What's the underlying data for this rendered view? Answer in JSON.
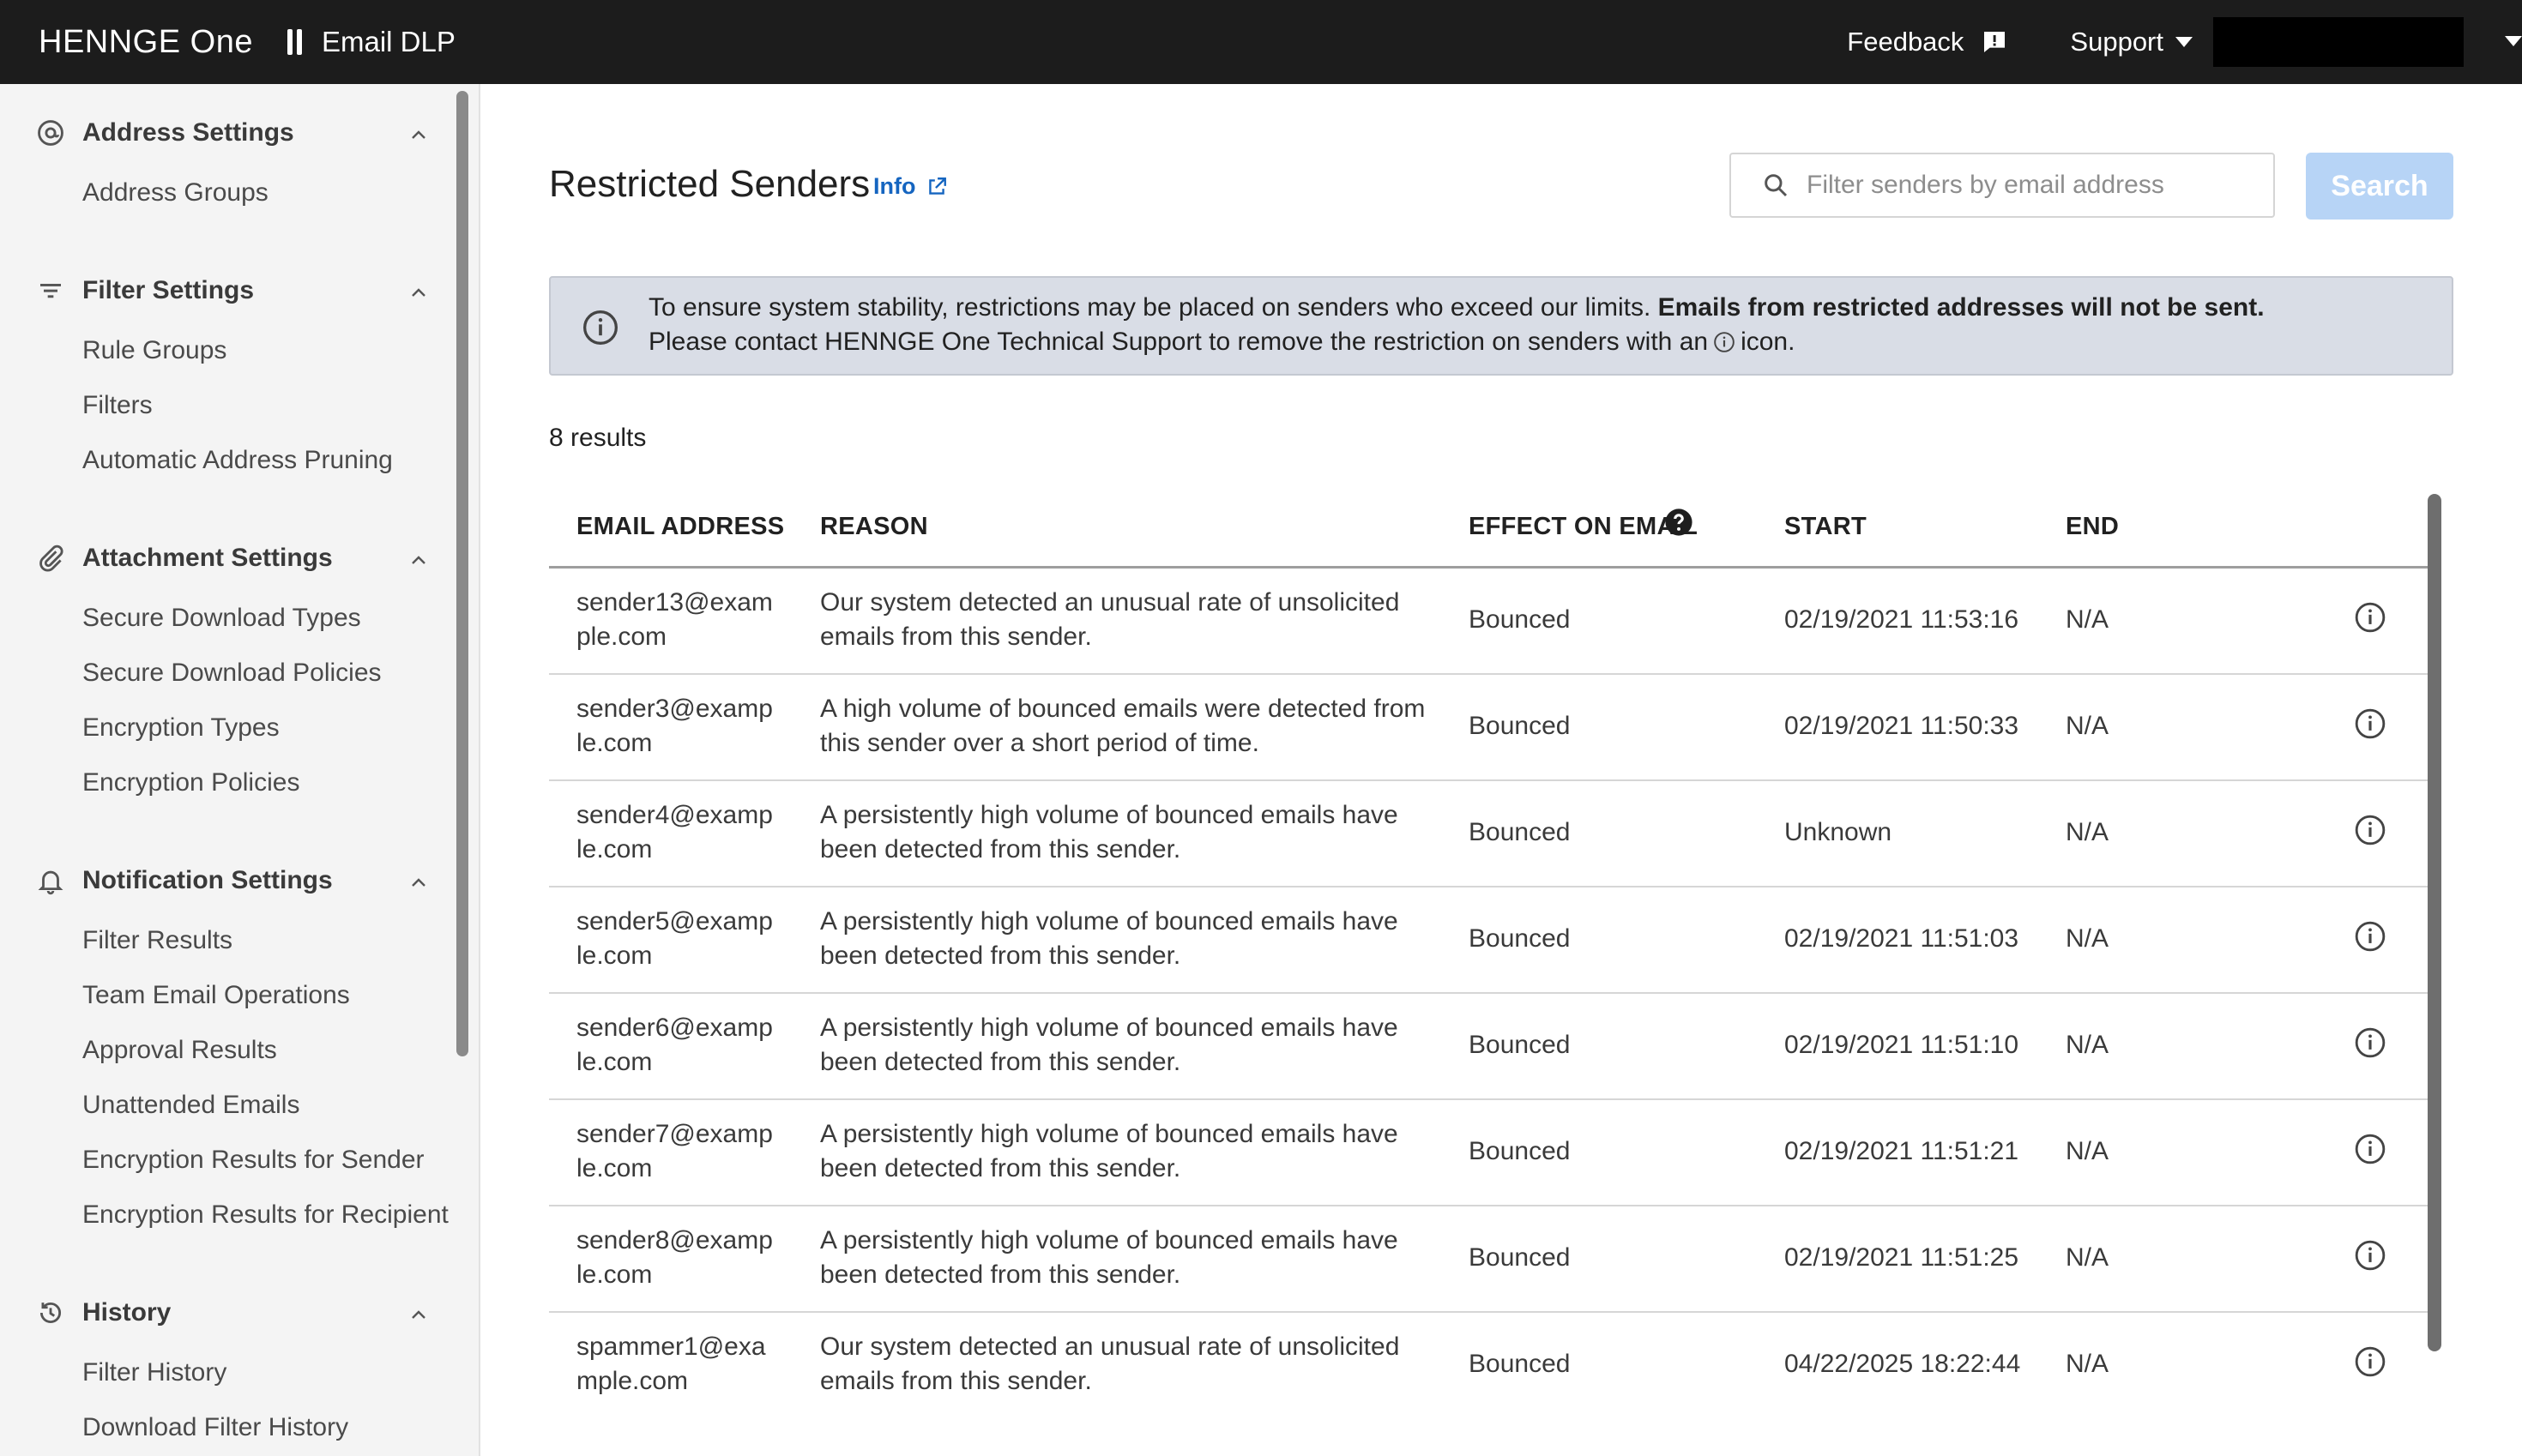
{
  "header": {
    "logo_text_a": "HENNGE",
    "logo_text_b": "One",
    "product": "Email DLP",
    "feedback_label": "Feedback",
    "support_label": "Support"
  },
  "sidebar": {
    "groups": [
      {
        "label": "Address Settings",
        "icon": "at-icon",
        "items": [
          "Address Groups"
        ]
      },
      {
        "label": "Filter Settings",
        "icon": "filter-icon",
        "items": [
          "Rule Groups",
          "Filters",
          "Automatic Address Pruning"
        ]
      },
      {
        "label": "Attachment Settings",
        "icon": "paperclip-icon",
        "items": [
          "Secure Download Types",
          "Secure Download Policies",
          "Encryption Types",
          "Encryption Policies"
        ]
      },
      {
        "label": "Notification Settings",
        "icon": "bell-icon",
        "items": [
          "Filter Results",
          "Team Email Operations",
          "Approval Results",
          "Unattended Emails",
          "Encryption Results for Sender",
          "Encryption Results for Recipient"
        ]
      },
      {
        "label": "History",
        "icon": "history-icon",
        "items": [
          "Filter History",
          "Download Filter History"
        ]
      }
    ]
  },
  "main": {
    "title": "Restricted Senders",
    "info_label": "Info",
    "search": {
      "placeholder": "Filter senders by email address",
      "button_label": "Search"
    },
    "notice": {
      "line1_plain": "To ensure system stability, restrictions may be placed on senders who exceed our limits. ",
      "line1_bold": "Emails from restricted addresses will not be sent.",
      "line2_before": "Please contact HENNGE One Technical Support to remove the restriction on senders with an",
      "line2_after": "icon."
    },
    "result_count": "8 results",
    "table": {
      "columns": {
        "email": "EMAIL ADDRESS",
        "reason": "REASON",
        "effect": "EFFECT ON EMAIL",
        "start": "START",
        "end": "END"
      },
      "rows": [
        {
          "email": "sender13@example.com",
          "reason": "Our system detected an unusual rate of unsolicited emails from this sender.",
          "effect": "Bounced",
          "start": "02/19/2021 11:53:16",
          "end": "N/A"
        },
        {
          "email": "sender3@example.com",
          "reason": "A high volume of bounced emails were detected from this sender over a short period of time.",
          "effect": "Bounced",
          "start": "02/19/2021 11:50:33",
          "end": "N/A"
        },
        {
          "email": "sender4@example.com",
          "reason": "A persistently high volume of bounced emails have been detected from this sender.",
          "effect": "Bounced",
          "start": "Unknown",
          "end": "N/A"
        },
        {
          "email": "sender5@example.com",
          "reason": "A persistently high volume of bounced emails have been detected from this sender.",
          "effect": "Bounced",
          "start": "02/19/2021 11:51:03",
          "end": "N/A"
        },
        {
          "email": "sender6@example.com",
          "reason": "A persistently high volume of bounced emails have been detected from this sender.",
          "effect": "Bounced",
          "start": "02/19/2021 11:51:10",
          "end": "N/A"
        },
        {
          "email": "sender7@example.com",
          "reason": "A persistently high volume of bounced emails have been detected from this sender.",
          "effect": "Bounced",
          "start": "02/19/2021 11:51:21",
          "end": "N/A"
        },
        {
          "email": "sender8@example.com",
          "reason": "A persistently high volume of bounced emails have been detected from this sender.",
          "effect": "Bounced",
          "start": "02/19/2021 11:51:25",
          "end": "N/A"
        },
        {
          "email": "spammer1@example.com",
          "reason": "Our system detected an unusual rate of unsolicited emails from this sender.",
          "effect": "Bounced",
          "start": "04/22/2025 18:22:44",
          "end": "N/A"
        }
      ]
    }
  },
  "colors": {
    "header_bg": "#1c1c1c",
    "sidebar_bg": "#f4f4f4",
    "link": "#1565c0",
    "search_button": "#b7d4f6",
    "notice_bg": "#d9dde6"
  }
}
